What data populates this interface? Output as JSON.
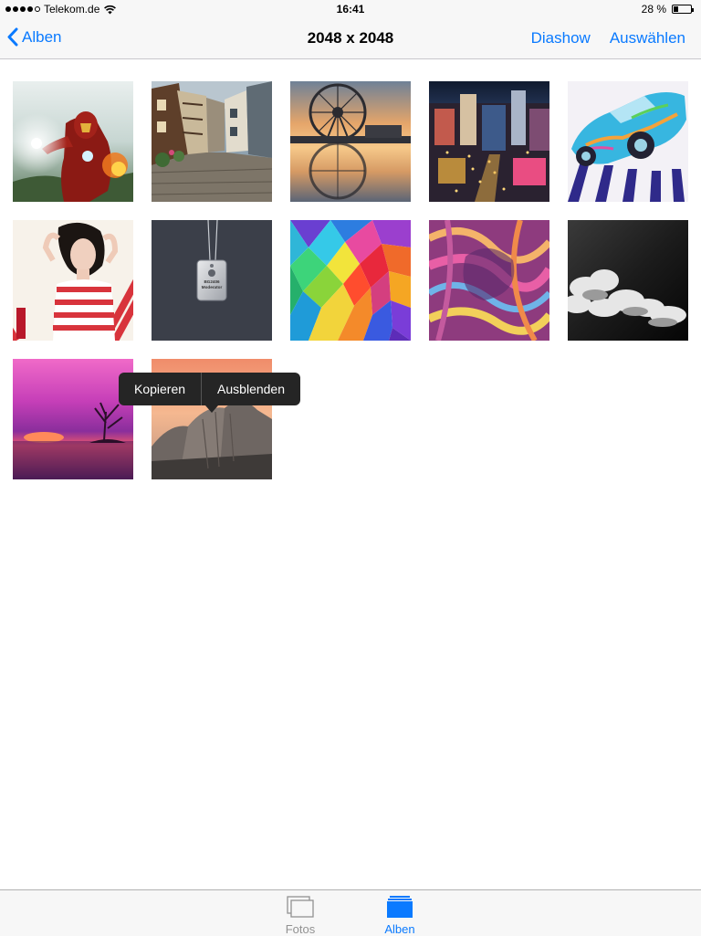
{
  "status_bar": {
    "carrier": "Telekom.de",
    "signal_bars": 4,
    "signal_total": 5,
    "time": "16:41",
    "battery_text": "28 %",
    "battery_level": 0.28
  },
  "nav": {
    "back_label": "Alben",
    "title": "2048 x 2048",
    "slideshow_label": "Diashow",
    "select_label": "Auswählen"
  },
  "photos": [
    {
      "subject": "iron-man"
    },
    {
      "subject": "cobblestone-street"
    },
    {
      "subject": "ferris-wheel-reflection"
    },
    {
      "subject": "city-at-night"
    },
    {
      "subject": "psychedelic-car"
    },
    {
      "subject": "woman-striped-dress"
    },
    {
      "subject": "dog-tag-moderator",
      "tag_line1": "BG2406",
      "tag_line2": "Moderator"
    },
    {
      "subject": "polygon-rainbow"
    },
    {
      "subject": "abstract-swirls"
    },
    {
      "subject": "clouds-black-white"
    },
    {
      "subject": "pink-sunset-tree"
    },
    {
      "subject": "half-dome-mountain"
    }
  ],
  "context_menu": {
    "copy_label": "Kopieren",
    "hide_label": "Ausblenden"
  },
  "tab_bar": {
    "fotos_label": "Fotos",
    "alben_label": "Alben",
    "selected": "Alben"
  },
  "colors": {
    "accent": "#0a7aff",
    "inactive_tab": "#929292",
    "bar_background": "#f7f7f7",
    "popover_background": "#252525"
  }
}
